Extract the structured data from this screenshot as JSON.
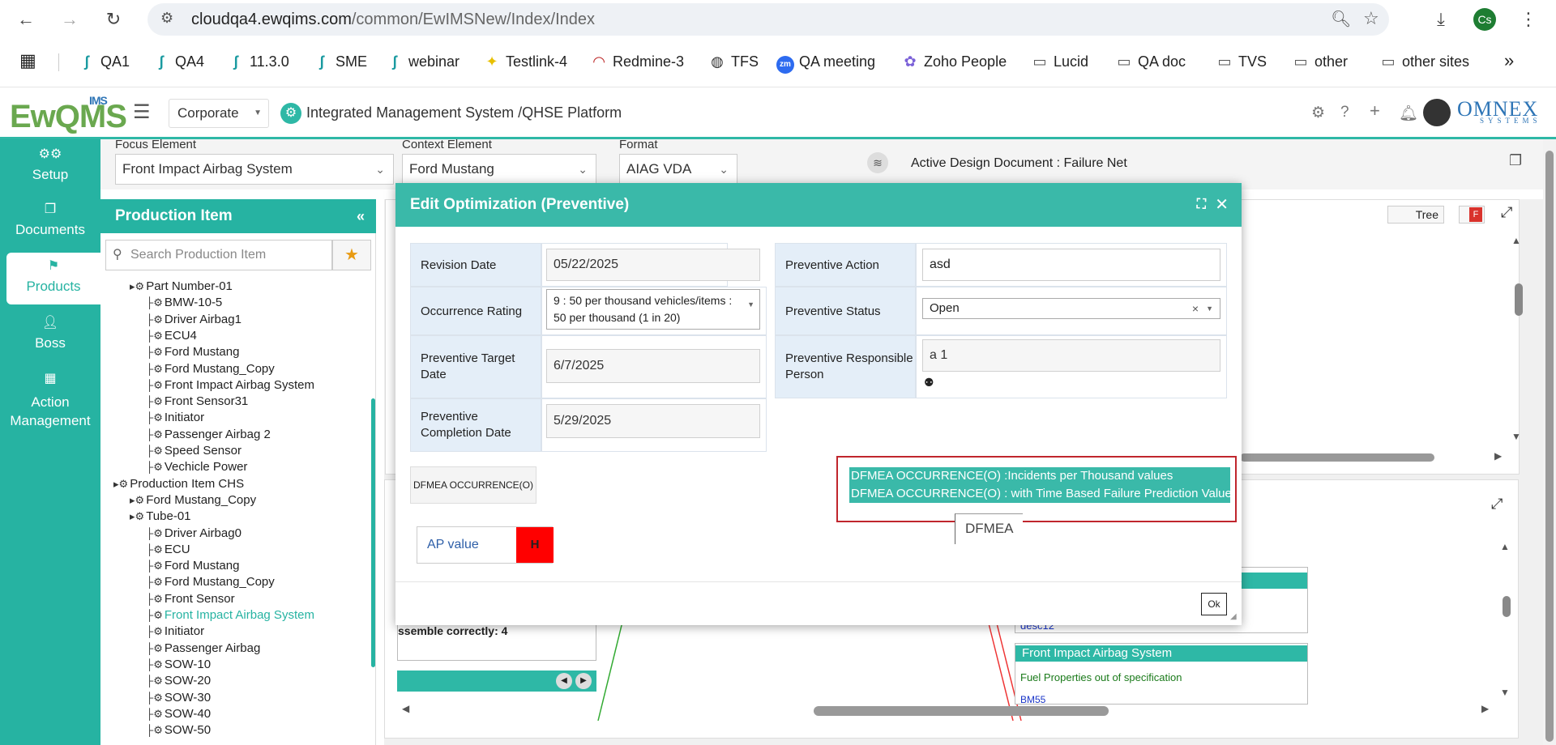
{
  "browser": {
    "url_host": "cloudqa4.ewqims.com",
    "url_path": "/common/EwIMSNew/Index/Index",
    "profile_initials": "Cs",
    "bookmarks": [
      "QA1",
      "QA4",
      "11.3.0",
      "SME",
      "webinar",
      "Testlink-4",
      "Redmine-3",
      "TFS",
      "QA meeting",
      "Zoho People",
      "Lucid",
      "QA doc",
      "TVS",
      "other",
      "other sites"
    ],
    "more": "»"
  },
  "header": {
    "logo_main": "EwQMS",
    "logo_sup": "IMS",
    "org_select": "Corporate",
    "platform_title": "Integrated Management System /QHSE Platform",
    "brand": "OMNEX",
    "brand_sub": "SYSTEMS"
  },
  "leftnav": {
    "items": [
      {
        "label": "Setup",
        "icon": "gears-icon"
      },
      {
        "label": "Documents",
        "icon": "documents-icon"
      },
      {
        "label": "Products",
        "icon": "products-icon",
        "active": true
      },
      {
        "label": "Boss",
        "icon": "boss-icon"
      },
      {
        "label": "Action Management",
        "icon": "action-icon"
      }
    ]
  },
  "filters": {
    "focus_label": "Focus Element",
    "focus_value": "Front Impact Airbag System",
    "context_label": "Context Element",
    "context_value": "Ford Mustang",
    "format_label": "Format",
    "format_value": "AIAG VDA",
    "active_doc": "Active Design Document : Failure Net"
  },
  "production_panel": {
    "title": "Production Item",
    "search_placeholder": "Search Production Item",
    "tree": [
      {
        "label": "Part Number-01",
        "level": 1
      },
      {
        "label": "BMW-10-5",
        "level": 2
      },
      {
        "label": "Driver Airbag1",
        "level": 2
      },
      {
        "label": "ECU4",
        "level": 2
      },
      {
        "label": "Ford Mustang",
        "level": 2
      },
      {
        "label": "Ford Mustang_Copy",
        "level": 2
      },
      {
        "label": "Front Impact Airbag System",
        "level": 2
      },
      {
        "label": "Front Sensor31",
        "level": 2
      },
      {
        "label": "Initiator",
        "level": 2
      },
      {
        "label": "Passenger Airbag 2",
        "level": 2
      },
      {
        "label": "Speed Sensor",
        "level": 2
      },
      {
        "label": "Vechicle Power",
        "level": 2
      },
      {
        "label": "Production Item CHS",
        "level": 0
      },
      {
        "label": "Ford Mustang_Copy",
        "level": 1
      },
      {
        "label": "Tube-01",
        "level": 1
      },
      {
        "label": "Driver Airbag0",
        "level": 2
      },
      {
        "label": "ECU",
        "level": 2
      },
      {
        "label": "Ford Mustang",
        "level": 2
      },
      {
        "label": "Ford Mustang_Copy",
        "level": 2
      },
      {
        "label": "Front Sensor",
        "level": 2
      },
      {
        "label": "Front Impact Airbag System",
        "level": 2,
        "selected": true
      },
      {
        "label": "Initiator",
        "level": 2
      },
      {
        "label": "Passenger Airbag",
        "level": 2
      },
      {
        "label": "SOW-10",
        "level": 2
      },
      {
        "label": "SOW-20",
        "level": 2
      },
      {
        "label": "SOW-30",
        "level": 2
      },
      {
        "label": "SOW-40",
        "level": 2
      },
      {
        "label": "SOW-50",
        "level": 2
      }
    ]
  },
  "background": {
    "tree_toggle": "Tree",
    "f_toggle": "F",
    "assemble_text": "ssemble correctly: 4",
    "desc_text": "desc12",
    "box_title": "Front Impact Airbag System",
    "fuel_text": "Fuel Properties out of specification",
    "bm_text": "BM55"
  },
  "modal": {
    "title": "Edit Optimization (Preventive)",
    "revision_date_label": "Revision Date",
    "revision_date": "05/22/2025",
    "occurrence_label": "Occurrence Rating",
    "occurrence_value": "9 : 50 per thousand vehicles/items : 50 per thousand (1 in 20)",
    "target_date_label": "Preventive Target Date",
    "target_date": "6/7/2025",
    "completion_label": "Preventive Completion Date",
    "completion_date": "5/29/2025",
    "action_label": "Preventive Action",
    "action_value": "asd",
    "status_label": "Preventive Status",
    "status_value": "Open",
    "person_label": "Preventive Responsible Person",
    "person_value": "a 1",
    "dfmea_button": "DFMEA OCCURRENCE(O)",
    "ap_label": "AP value",
    "ap_value": "H",
    "ok": "Ok"
  },
  "dropdown": {
    "options": [
      "DFMEA OCCURRENCE(O) :Incidents per Thousand values",
      "DFMEA OCCURRENCE(O) : with Time Based Failure Prediction Values"
    ],
    "input_value": "DFMEA"
  },
  "colors": {
    "teal": "#26b3a2",
    "ap_high": "#ff0000",
    "highlight_border": "#c0262d"
  }
}
